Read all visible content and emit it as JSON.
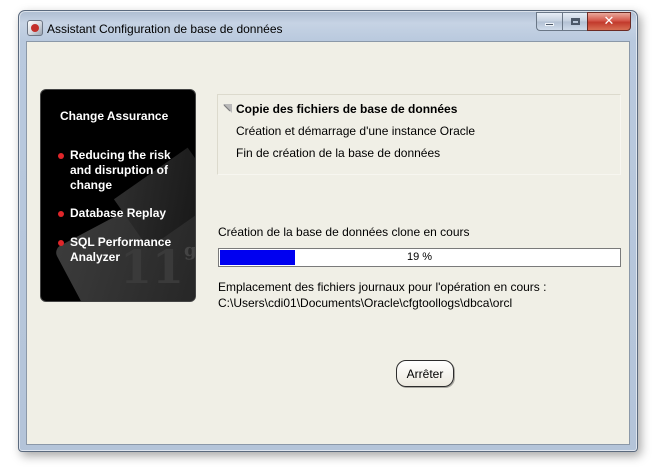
{
  "window": {
    "title": "Assistant Configuration de base de données",
    "close_glyph": "✕"
  },
  "brand_panel": {
    "heading": "Change Assurance",
    "items": [
      "Reducing the risk and disruption of change",
      "Database Replay",
      "SQL Performance Analyzer"
    ],
    "bullet_color": "#e0262a",
    "watermark": "11g"
  },
  "steps": [
    {
      "label": "Copie des fichiers de base de données",
      "current": true,
      "icon": "arrow-icon"
    },
    {
      "label": "Création et démarrage d'une instance Oracle",
      "current": false
    },
    {
      "label": "Fin de création de la base de données",
      "current": false
    }
  ],
  "status_text": "Création de la base de données clone en cours",
  "progress": {
    "percent": 19,
    "label": "19 %",
    "fill_color": "#0000f0"
  },
  "log": {
    "label": "Emplacement des fichiers journaux pour l'opération en cours :",
    "path": "C:\\Users\\cdi01\\Documents\\Oracle\\cfgtoollogs\\dbca\\orcl"
  },
  "buttons": {
    "stop_label": "Arrêter"
  }
}
